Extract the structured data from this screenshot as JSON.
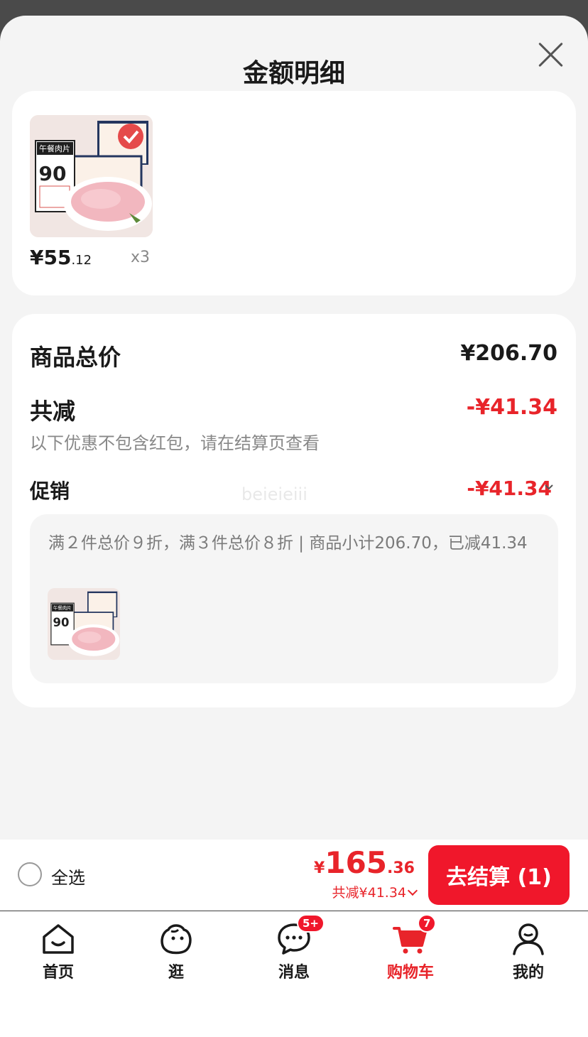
{
  "sheet": {
    "title": "金额明细"
  },
  "product": {
    "price_int": "¥55",
    "price_dec": ".12",
    "quantity": "x3",
    "thumb_text_1": "午餐肉片",
    "thumb_text_2": "90"
  },
  "detail": {
    "total_label": "商品总价",
    "total_value": "¥206.70",
    "discount_label": "共减",
    "discount_value": "-¥41.34",
    "discount_note": "以下优惠不包含红包，请在结算页查看",
    "promo_label": "促销",
    "promo_value": "-¥41.34",
    "promo_text": "满２件总价９折，满３件总价８折 | 商品小计206.70，已减41.34"
  },
  "watermark": "beieieiii",
  "checkout": {
    "select_all": "全选",
    "yen": "¥",
    "amount_int": "165",
    "amount_dec": ".36",
    "saved": "共减¥41.34",
    "button": "去结算 (1)"
  },
  "tabs": [
    {
      "label": "首页",
      "icon": "home-icon"
    },
    {
      "label": "逛",
      "icon": "browse-icon"
    },
    {
      "label": "消息",
      "icon": "message-icon",
      "badge": "5+"
    },
    {
      "label": "购物车",
      "icon": "cart-icon",
      "badge": "7"
    },
    {
      "label": "我的",
      "icon": "profile-icon"
    }
  ],
  "colors": {
    "accent": "#e8242a",
    "button": "#f0172b",
    "background": "#f4f4f4"
  }
}
